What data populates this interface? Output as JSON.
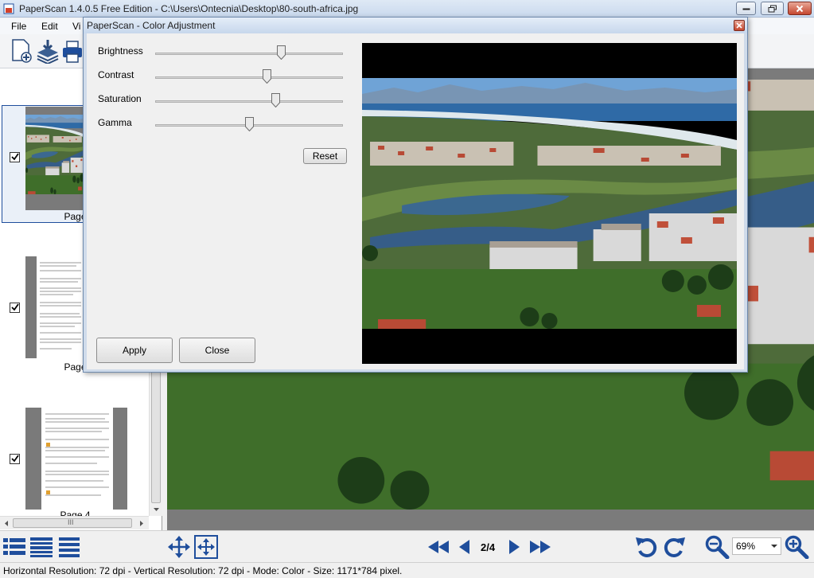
{
  "window": {
    "title": "PaperScan 1.4.0.5 Free Edition - C:\\Users\\Ontecnia\\Desktop\\80-south-africa.jpg"
  },
  "menu": {
    "items": [
      "File",
      "Edit",
      "Vi"
    ]
  },
  "thumbnails": [
    {
      "label": "Page",
      "checked": true
    },
    {
      "label": "Page",
      "checked": true
    },
    {
      "label": "Page 4",
      "checked": true
    }
  ],
  "hscroll_grip": "III",
  "bottombar": {
    "page_indicator": "2/4",
    "zoom": "69%"
  },
  "status": {
    "text": "Horizontal Resolution:  72 dpi - Vertical Resolution:  72 dpi - Mode: Color - Size: 1171*784 pixel."
  },
  "dialog": {
    "title": "PaperScan - Color Adjustment",
    "sliders": [
      {
        "label": "Brightness",
        "value": 0.68
      },
      {
        "label": "Contrast",
        "value": 0.6
      },
      {
        "label": "Saturation",
        "value": 0.65
      },
      {
        "label": "Gamma",
        "value": 0.5
      }
    ],
    "reset_label": "Reset",
    "apply_label": "Apply",
    "close_label": "Close"
  },
  "icons": {
    "app": "app-logo-icon",
    "new": "new-document-icon",
    "scan": "scan-stack-icon",
    "print": "print-icon",
    "view_list_large": "thumbnails-large-icon",
    "view_list_medium": "thumbnails-medium-icon",
    "view_list_small": "thumbnails-small-icon",
    "pan": "pan-move-icon",
    "fit": "fit-to-window-icon",
    "first": "first-page-icon",
    "prev": "previous-page-icon",
    "next": "next-page-icon",
    "last": "last-page-icon",
    "rotate_left": "rotate-left-icon",
    "rotate_right": "rotate-right-icon",
    "zoom_out": "zoom-out-icon",
    "zoom_in": "zoom-in-icon"
  },
  "colors": {
    "accent_blue": "#1f4e9c",
    "title_bar": "#c9d9ee",
    "close_red": "#c5472f"
  }
}
